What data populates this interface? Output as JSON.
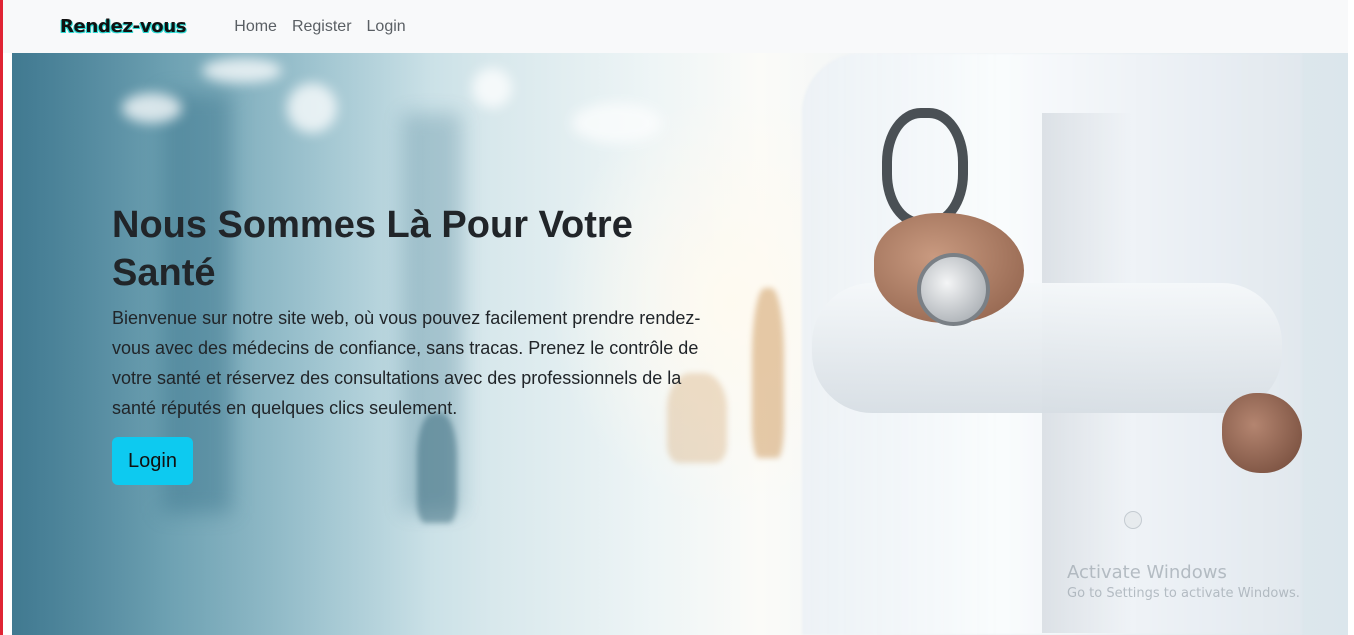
{
  "navbar": {
    "brand": "Rendez-vous",
    "links": [
      "Home",
      "Register",
      "Login"
    ]
  },
  "hero": {
    "title": "Nous Sommes Là Pour Votre Santé",
    "description": "Bienvenue sur notre site web, où vous pouvez facilement prendre rendez-vous avec des médecins de confiance, sans tracas. Prenez le contrôle de votre santé et réservez des consultations avec des professionnels de la santé réputés en quelques clics seulement.",
    "button_label": "Login"
  },
  "watermark": {
    "title": "Activate Windows",
    "subtitle": "Go to Settings to activate Windows."
  },
  "colors": {
    "accent": "#0dcaf0",
    "navbar_bg": "#f8f9fa",
    "brand_glow": "#2bd9d2",
    "left_edge": "#e02434"
  },
  "hero_image": "doctor-with-stethoscope-in-hospital-corridor"
}
